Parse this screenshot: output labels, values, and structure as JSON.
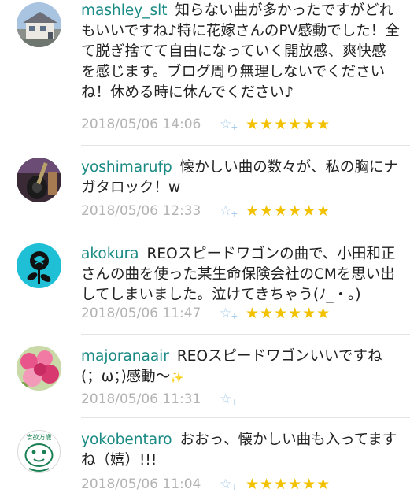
{
  "comments": [
    {
      "username": "mashley_slt",
      "text": "知らない曲が多かったですがどれもいいですね♪特に花嫁さんのPV感動でした！全て脱ぎ捨てて自由になっていく開放感、爽快感を感じます。ブログ周り無理しないでくださいね！休める時に休んでください♪",
      "timestamp": "2018/05/06 14:06",
      "stars": "★★★★★★",
      "avatar": "house-photo"
    },
    {
      "username": "yoshimarufp",
      "text": "懐かしい曲の数々が、私の胸にナガタロック！w",
      "timestamp": "2018/05/06 12:33",
      "stars": "★★★★★★",
      "avatar": "guitar-photo"
    },
    {
      "username": "akokura",
      "text": "REOスピードワゴンの曲で、小田和正さんの曲を使った某生命保険会社のCMを思い出してしまいました。泣けてきちゃう(ﾉ_・｡)",
      "timestamp": "2018/05/06 11:47",
      "stars": "★★★★★★",
      "avatar": "rose-silhouette"
    },
    {
      "username": "majoranaair",
      "text": "REOスピードワゴンいいですね(；ω；)感動〜",
      "timestamp": "2018/05/06 11:31",
      "stars": "",
      "avatar": "flowers-photo"
    },
    {
      "username": "yokobentaro",
      "text": "おおっ、懐かしい曲も入ってますね（嬉）!!!",
      "timestamp": "2018/05/06 11:04",
      "stars": "★★★★★★",
      "avatar": "cartoon-face",
      "avatar_text": "食欲万歳"
    }
  ],
  "icons": {
    "add_star": "☆",
    "add_star_plus": "+",
    "sparkle": "✨"
  },
  "colors": {
    "username": "#1a8a84",
    "star": "#f2c200",
    "add_star": "#9fc8ec",
    "timestamp": "#b3b3b3"
  }
}
